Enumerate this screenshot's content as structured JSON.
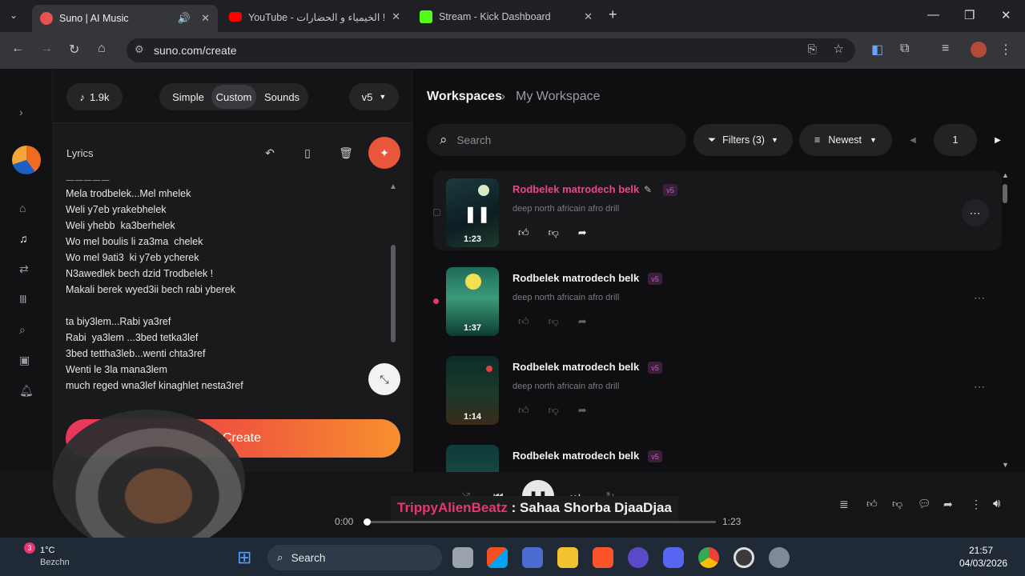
{
  "browser": {
    "tabs": [
      {
        "title": "Suno | AI Music",
        "fav_color": "#e8534f"
      },
      {
        "title": "YouTube - الخيمياء و الحضارات !",
        "fav_color": "#ff0000"
      },
      {
        "title": "Stream - Kick Dashboard",
        "fav_color": "#53fc18"
      }
    ],
    "new_tab_label": "+",
    "url": "suno.com/create"
  },
  "left": {
    "credits": "1.9k",
    "mode_simple": "Simple",
    "mode_custom": "Custom",
    "mode_sounds": "Sounds",
    "model": "v5",
    "lyrics_label": "Lyrics",
    "lyrics_text": "Mela trodbelek...Mel mhelek\nWeli y7eb yrakebhelek\nWeli yhebb  ka3berhelek\nWo mel boulis li za3ma  chelek\nWo mel 9ati3  ki y7eb ycherek\nN3awedlek bech dzid Trodbelek !\nMakali berek wyed3ii bech rabi yberek\n\nta biy3lem...Rabi ya3ref\nRabi  ya3lem ...3bed tetka3lef\n3bed tettha3leb...wenti chta3ref\nWenti le 3la mana3lem\nmuch reged wna3lef kinaghlet nesta3ref",
    "create_label": "Create"
  },
  "right": {
    "breadcrumb_root": "Workspaces",
    "breadcrumb_current": "My Workspace",
    "search_placeholder": "Search",
    "filters_label": "Filters (3)",
    "sort_label": "Newest",
    "page_number": "1",
    "songs": [
      {
        "title": "Rodbelek matrodech belk",
        "badge": "v5",
        "desc": "deep north africain afro drill",
        "duration": "1:23",
        "active": true
      },
      {
        "title": "Rodbelek matrodech belk",
        "badge": "v5",
        "desc": "deep north africain afro drill",
        "duration": "1:37",
        "active": false
      },
      {
        "title": "Rodbelek matrodech belk",
        "badge": "v5",
        "desc": "deep north africain afro drill",
        "duration": "1:14",
        "active": false
      },
      {
        "title": "Rodbelek matrodech belk",
        "badge": "v5",
        "desc": "",
        "duration": "",
        "active": false
      }
    ]
  },
  "player": {
    "overlay_user": "TrippyAlienBeatz",
    "overlay_sep": " : ",
    "overlay_msg": "Sahaa Shorba DjaaDjaa",
    "time_current": "0:00",
    "time_total": "1:23",
    "progress": 0.0
  },
  "taskbar": {
    "weather_temp": "1°C",
    "weather_loc": "Bezchn",
    "weather_badge": "3",
    "search_label": "Search",
    "time": "21:57",
    "date": "04/03/2026"
  },
  "colors": {
    "accent": "#e8366f",
    "create_start": "#e8365b",
    "create_end": "#f7902f",
    "v5_badge": "#3b1f3d"
  }
}
